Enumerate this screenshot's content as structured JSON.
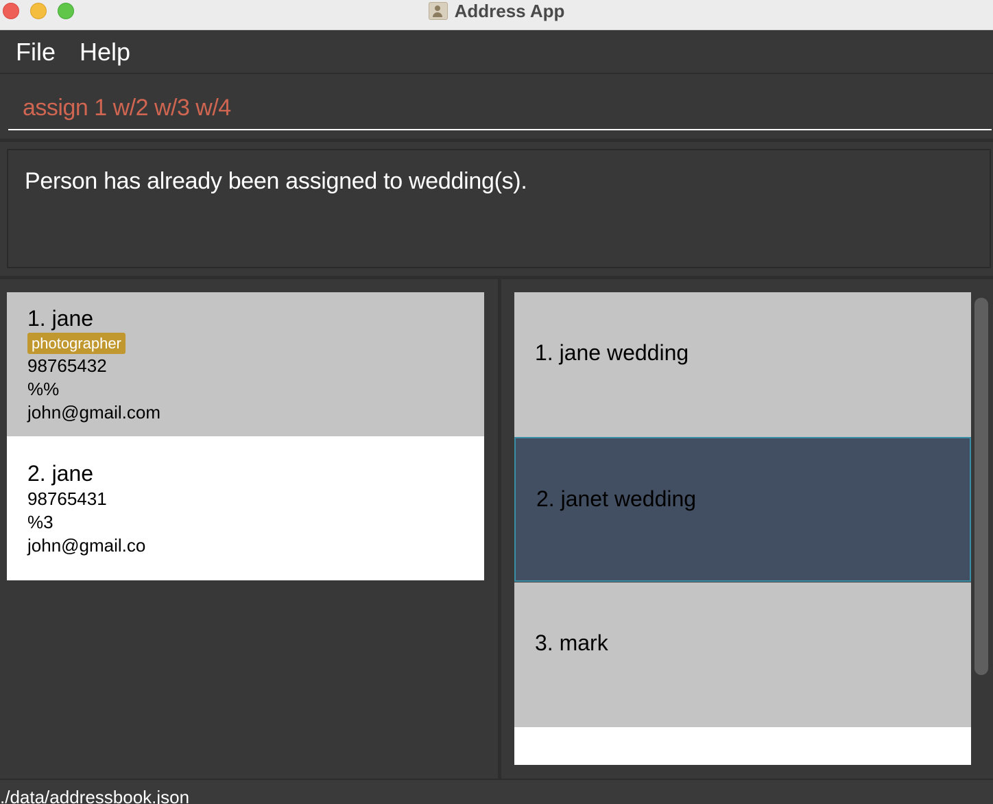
{
  "window": {
    "title": "Address App",
    "icon": "address-book-icon",
    "controls": [
      "close",
      "minimize",
      "maximize"
    ]
  },
  "menu": {
    "items": [
      {
        "label": "File"
      },
      {
        "label": "Help"
      }
    ]
  },
  "command": {
    "value": "assign 1 w/2 w/3 w/4"
  },
  "result": {
    "message": "Person has already been assigned to wedding(s)."
  },
  "persons": [
    {
      "name": "1. jane",
      "tag": "photographer",
      "phone": "98765432",
      "address": "%%",
      "email": "john@gmail.com"
    },
    {
      "name": "2. jane",
      "phone": "98765431",
      "address": "%3",
      "email": "john@gmail.co"
    }
  ],
  "weddings": [
    {
      "name": "1. jane wedding"
    },
    {
      "name": "2. janet wedding",
      "selected": true
    },
    {
      "name": "3. mark"
    }
  ],
  "status": {
    "file_path": "./data/addressbook.json"
  },
  "colors": {
    "command_text": "#d06651",
    "tag_bg": "#c0982f",
    "selected_card_bg": "#424e61",
    "selected_border": "#3a8fa6",
    "card_bg": "#c4c4c4",
    "panel_bg": "#383838"
  }
}
